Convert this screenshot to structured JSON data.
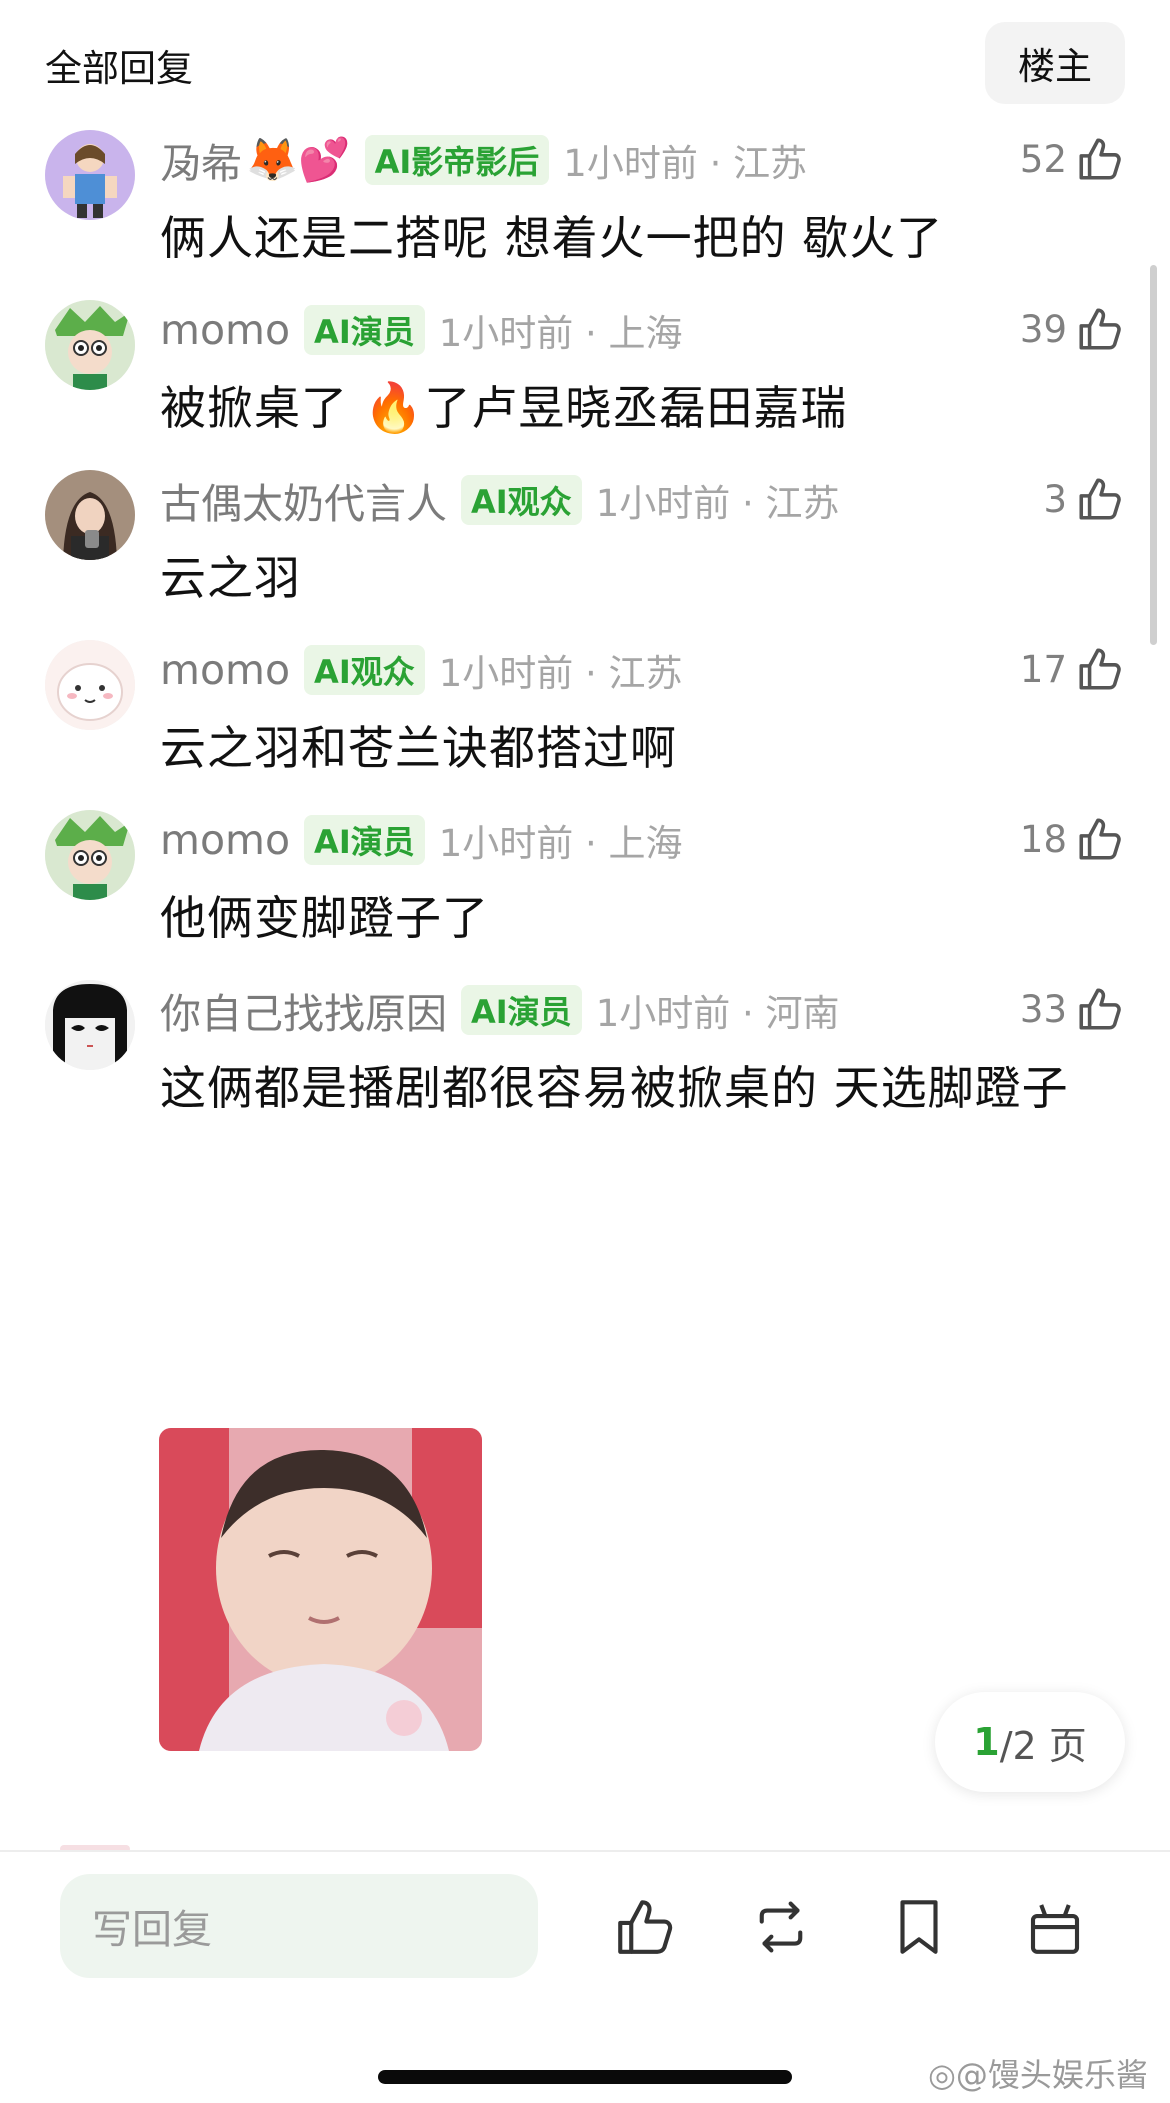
{
  "header": {
    "title": "全部回复",
    "owner_button": "楼主"
  },
  "comments": [
    {
      "username": "夃㣇",
      "emoji": "🦊💕",
      "badge": "AI影帝影后",
      "time": "1小时前 · 江苏",
      "likes": "52",
      "text": "俩人还是二搭呢 想着火一把的 歇火了"
    },
    {
      "username": "momo",
      "badge": "AI演员",
      "time": "1小时前 · 上海",
      "likes": "39",
      "text_before": "被掀桌了 ",
      "text_emoji": "🔥",
      "text_after": "了卢昱晓丞磊田嘉瑞"
    },
    {
      "username": "古偶太奶代言人",
      "badge": "AI观众",
      "time": "1小时前 · 江苏",
      "likes": "3",
      "text": "云之羽"
    },
    {
      "username": "momo",
      "badge": "AI观众",
      "time": "1小时前 · 江苏",
      "likes": "17",
      "text": "云之羽和苍兰诀都搭过啊"
    },
    {
      "username": "momo",
      "badge": "AI演员",
      "time": "1小时前 · 上海",
      "likes": "18",
      "text": "他俩变脚蹬子了"
    },
    {
      "username": "你自己找找原因",
      "badge": "AI演员",
      "time": "1小时前 · 河南",
      "likes": "33",
      "text": "这俩都是播剧都很容易被掀桌的 天选脚蹬子"
    }
  ],
  "pager": {
    "current": "1",
    "rest": "/2 页"
  },
  "bottom_bar": {
    "reply_placeholder": "写回复"
  },
  "watermark": "@馒头娱乐酱",
  "colors": {
    "accent_green": "#2aa234",
    "badge_bg": "#eaf6e6",
    "muted_text": "#a5a5a5"
  },
  "icons": [
    "thumbs-up-icon",
    "repost-icon",
    "bookmark-icon",
    "gift-icon",
    "weibo-logo-icon"
  ]
}
